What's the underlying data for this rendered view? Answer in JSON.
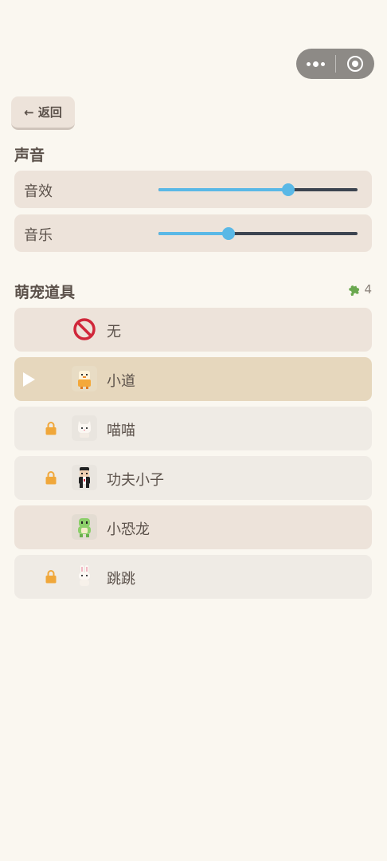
{
  "nav": {
    "back_label": "← 返回"
  },
  "sound": {
    "title": "声音",
    "sfx": {
      "label": "音效",
      "value": 0.65
    },
    "music": {
      "label": "音乐",
      "value": 0.35
    }
  },
  "pets": {
    "title": "萌宠道具",
    "puzzle_count": "4",
    "items": [
      {
        "name": "无",
        "icon": "prohibited-icon",
        "locked": false,
        "selected": false
      },
      {
        "name": "小道",
        "icon": "chick-avatar",
        "locked": false,
        "selected": true
      },
      {
        "name": "喵喵",
        "icon": "cat-avatar",
        "locked": true,
        "selected": false
      },
      {
        "name": "功夫小子",
        "icon": "kungfu-boy-avatar",
        "locked": true,
        "selected": false
      },
      {
        "name": "小恐龙",
        "icon": "dino-avatar",
        "locked": false,
        "selected": false
      },
      {
        "name": "跳跳",
        "icon": "bunny-avatar",
        "locked": true,
        "selected": false
      }
    ]
  },
  "colors": {
    "slider_fill": "#5ab8e6",
    "slider_track": "#3c4450",
    "lock": "#f0a73a",
    "puzzle": "#6aa84f"
  }
}
